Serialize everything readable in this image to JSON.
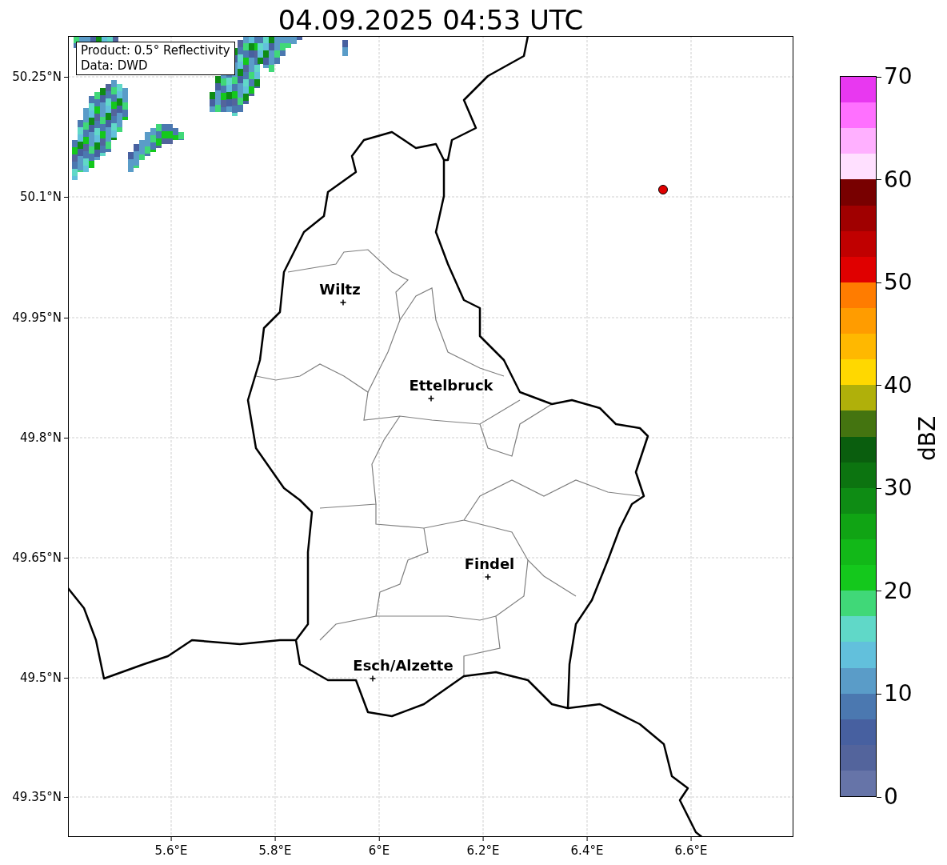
{
  "title": "04.09.2025 04:53 UTC",
  "map": {
    "info_box": [
      "Product: 0.5° Reflectivity",
      "Data: DWD"
    ],
    "cities": [
      {
        "name": "Wiltz"
      },
      {
        "name": "Ettelbruck"
      },
      {
        "name": "Findel"
      },
      {
        "name": "Esch/Alzette"
      }
    ],
    "x_ticks": [
      "5.6°E",
      "5.8°E",
      "6°E",
      "6.2°E",
      "6.4°E",
      "6.6°E"
    ],
    "y_ticks": [
      "50.25°N",
      "50.1°N",
      "49.95°N",
      "49.8°N",
      "49.65°N",
      "49.5°N",
      "49.35°N"
    ]
  },
  "colorbar": {
    "label": "dBZ",
    "ticks": [
      "70",
      "60",
      "50",
      "40",
      "30",
      "20",
      "10",
      "0"
    ],
    "bands": [
      {
        "color": "#e838f0"
      },
      {
        "color": "#ff70ff"
      },
      {
        "color": "#ffb0ff"
      },
      {
        "color": "#ffe0ff"
      },
      {
        "color": "#780000"
      },
      {
        "color": "#a00000"
      },
      {
        "color": "#c00000"
      },
      {
        "color": "#e00000"
      },
      {
        "color": "#ff7c00"
      },
      {
        "color": "#ff9c00"
      },
      {
        "color": "#ffb800"
      },
      {
        "color": "#ffd800"
      },
      {
        "color": "#b0b00a"
      },
      {
        "color": "#447410"
      },
      {
        "color": "#0a5e0e"
      },
      {
        "color": "#0c7410"
      },
      {
        "color": "#0e8c14"
      },
      {
        "color": "#10a414"
      },
      {
        "color": "#12b818"
      },
      {
        "color": "#14c81c"
      },
      {
        "color": "#40d878"
      },
      {
        "color": "#60d8c8"
      },
      {
        "color": "#62c0dc"
      },
      {
        "color": "#5a9cc8"
      },
      {
        "color": "#4b78b0"
      },
      {
        "color": "#4760a0"
      },
      {
        "color": "#53649c"
      },
      {
        "color": "#6674a8"
      }
    ]
  }
}
